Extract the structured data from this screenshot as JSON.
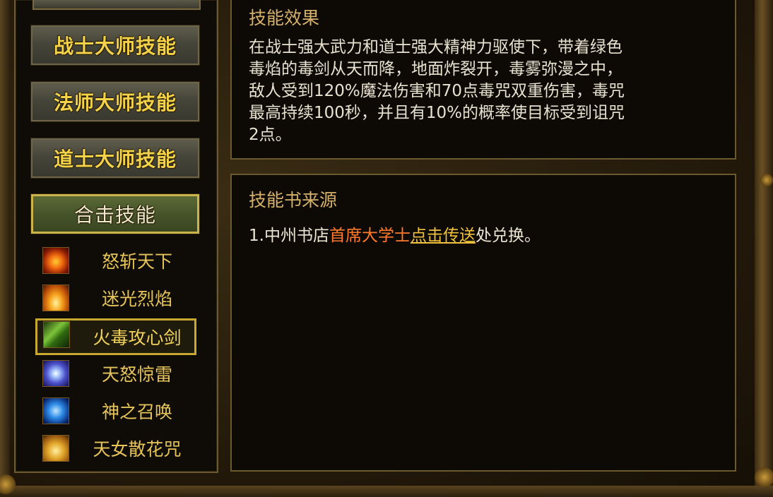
{
  "left_panel": {
    "class_buttons": [
      {
        "label": "战士大师技能"
      },
      {
        "label": "法师大师技能"
      },
      {
        "label": "道士大师技能"
      },
      {
        "label": "合击技能",
        "active": true
      }
    ],
    "skills": [
      {
        "name": "怒斩天下",
        "icon": "fire-slash-icon"
      },
      {
        "name": "迷光烈焰",
        "icon": "flame-icon"
      },
      {
        "name": "火毒攻心剑",
        "icon": "poison-sword-icon",
        "selected": true
      },
      {
        "name": "天怒惊雷",
        "icon": "lightning-orb-icon"
      },
      {
        "name": "神之召唤",
        "icon": "summon-orb-icon"
      },
      {
        "name": "天女散花咒",
        "icon": "golden-flower-icon"
      }
    ]
  },
  "effect": {
    "title": "技能效果",
    "lines": [
      "在战士强大武力和道士强大精神力驱使下，带着绿色",
      "毒焰的毒剑从天而降，地面炸裂开，毒雾弥漫之中，",
      "敌人受到120%魔法伤害和70点毒咒双重伤害，毒咒",
      "最高持续100秒，并且有10%的概率使目标受到诅咒",
      "2点。"
    ]
  },
  "source": {
    "title": "技能书来源",
    "prefix": "1.中州书店",
    "npc": "首席大学士",
    "link": "点击传送",
    "suffix": "处兑换。"
  }
}
